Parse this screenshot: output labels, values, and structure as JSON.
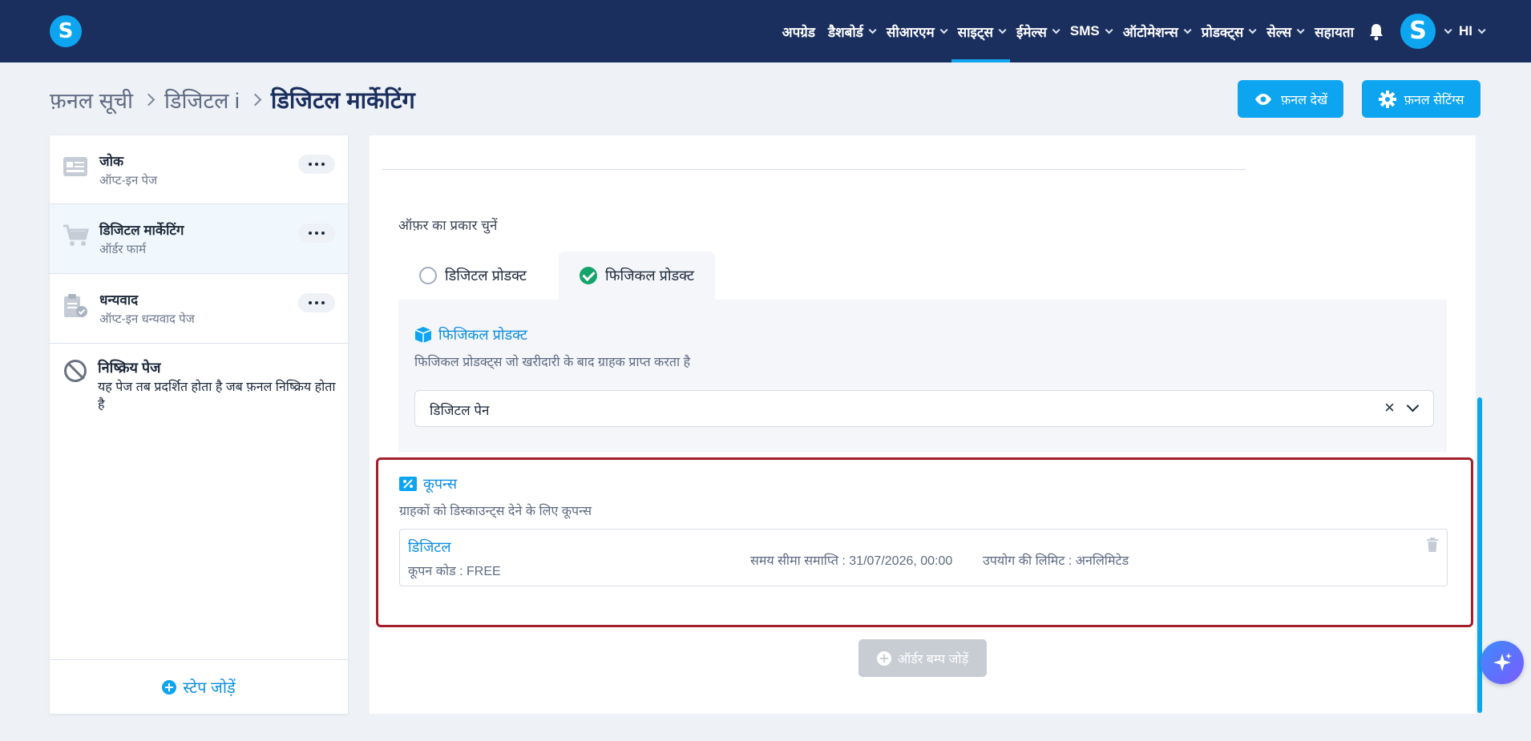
{
  "nav": {
    "items": [
      {
        "label": "अपग्रेड",
        "chevron": false,
        "active": false
      },
      {
        "label": "डैशबोर्ड",
        "chevron": true,
        "active": false
      },
      {
        "label": "सीआरएम",
        "chevron": true,
        "active": false
      },
      {
        "label": "साइट्स",
        "chevron": true,
        "active": true
      },
      {
        "label": "ईमेल्स",
        "chevron": true,
        "active": false
      },
      {
        "label": "SMS",
        "chevron": true,
        "active": false
      },
      {
        "label": "ऑटोमेशन्स",
        "chevron": true,
        "active": false
      },
      {
        "label": "प्रोडक्ट्स",
        "chevron": true,
        "active": false
      },
      {
        "label": "सेल्स",
        "chevron": true,
        "active": false
      },
      {
        "label": "सहायता",
        "chevron": false,
        "active": false
      }
    ],
    "logo_letter": "S",
    "avatar_letter": "S",
    "language": "HI",
    "accent_color": "#0ea5f0",
    "bg_color": "#1b2f5e"
  },
  "breadcrumb": {
    "root": "फ़नल सूची",
    "parent": "डिजिटल i",
    "current": "डिजिटल मार्केटिंग"
  },
  "actions": {
    "view_funnel": "फ़नल देखें",
    "funnel_settings": "फ़नल सेटिंग्स"
  },
  "sidebar": {
    "steps": [
      {
        "title": "जोक",
        "subtitle": "ऑप्ट-इन पेज",
        "icon": "optin-page-icon"
      },
      {
        "title": "डिजिटल मार्केटिंग",
        "subtitle": "ऑर्डर फार्म",
        "icon": "cart-icon"
      },
      {
        "title": "धन्यवाद",
        "subtitle": "ऑप्ट-इन धन्यवाद पेज",
        "icon": "clipboard-check-icon"
      }
    ],
    "inactive": {
      "title": "निष्क्रिय पेज",
      "description": "यह पेज तब प्रदर्शित होता है जब फ़नल निष्क्रिय होता है"
    },
    "add_step": "स्टेप जोड़ें"
  },
  "offer": {
    "label": "ऑफ़र का प्रकार चुनें",
    "tab_digital": "डिजिटल प्रोडक्ट",
    "tab_physical": "फिजिकल प्रोडक्ट",
    "selected": "physical"
  },
  "physical": {
    "title": "फिजिकल प्रोडक्ट",
    "description": "फिजिकल प्रोडक्ट्स जो खरीदारी के बाद ग्राहक प्राप्त करता है",
    "selected_product": "डिजिटल पेन"
  },
  "coupons": {
    "title": "कूपन्स",
    "description": "ग्राहकों को डिस्काउन्ट्स देने के लिए कूपन्स",
    "items": [
      {
        "name": "डिजिटल",
        "code": "कूपन कोड : FREE",
        "expiry": "समय सीमा समाप्ति : 31/07/2026, 00:00",
        "limit": "उपयोग की लिमिट : अनलिमिटेड"
      }
    ],
    "highlight_color": "#a31f2b"
  },
  "order_bump": {
    "label": "ऑर्डर बम्प जोड़ें"
  }
}
